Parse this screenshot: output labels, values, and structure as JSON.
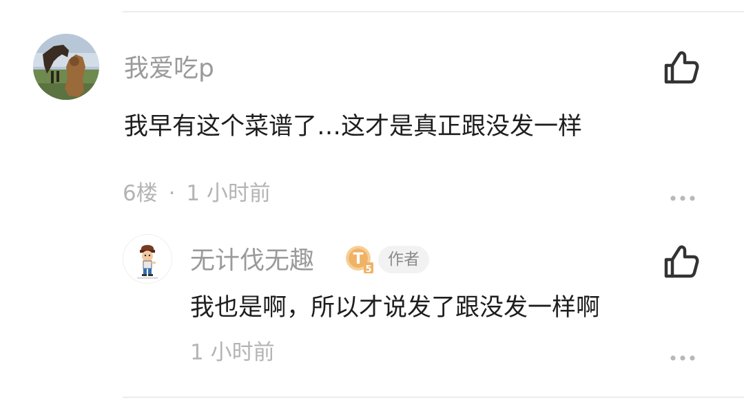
{
  "comment": {
    "username": "我爱吃p",
    "text": "我早有这个菜谱了…这才是真正跟没发一样",
    "floor": "6楼",
    "separator": "·",
    "time": "1 小时前",
    "avatar_icon": "horse-avatar",
    "like_icon": "thumbs-up-icon",
    "more_icon": "more-dots-icon"
  },
  "reply": {
    "username": "无计伐无趣",
    "level_badge": "T",
    "level_sub": "5",
    "author_tag": "作者",
    "text": "我也是啊，所以才说发了跟没发一样啊",
    "time": "1 小时前",
    "avatar_icon": "cartoon-boy-avatar",
    "like_icon": "thumbs-up-icon",
    "more_icon": "more-dots-icon"
  },
  "colors": {
    "username": "#9a9a9a",
    "text": "#1e1e1e",
    "meta": "#b4b4b4",
    "badge": "#f2b46a",
    "tag_bg": "#f2f2f2"
  }
}
